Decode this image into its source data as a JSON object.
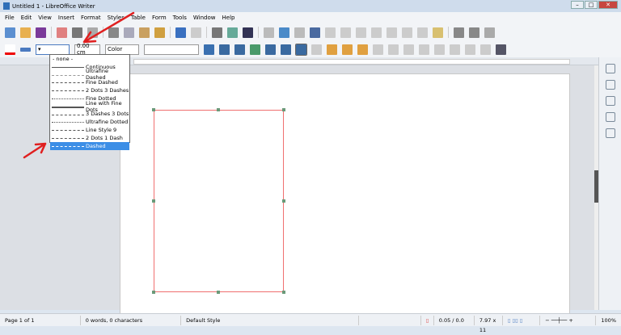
{
  "window": {
    "title": "Untitled 1 - LibreOffice Writer"
  },
  "menu": [
    "File",
    "Edit",
    "View",
    "Insert",
    "Format",
    "Styles",
    "Table",
    "Form",
    "Tools",
    "Window",
    "Help"
  ],
  "toolbar2": {
    "line_width": "0.00 cm",
    "area_style": "Color"
  },
  "line_style_dropdown": {
    "items": [
      "- none -",
      "Continuous",
      "Ultrafine Dashed",
      "Fine Dashed",
      "2 Dots 3 Dashes",
      "Fine Dotted",
      "Line with Fine Dots",
      "3 Dashes 3 Dots",
      "Ultrafine Dotted",
      "Line Style 9",
      "2 Dots 1 Dash",
      "Dashed"
    ],
    "selected": "Dashed"
  },
  "statusbar": {
    "page": "Page 1 of 1",
    "words": "0 words, 0 characters",
    "style": "Default Style",
    "position": "0.05 / 0.0",
    "size": "7.97 x 11",
    "zoom": "100%"
  },
  "colors": {
    "accent": "#3c8ee6",
    "frame_border": "#f07070",
    "annotation_arrow": "#e02020"
  }
}
